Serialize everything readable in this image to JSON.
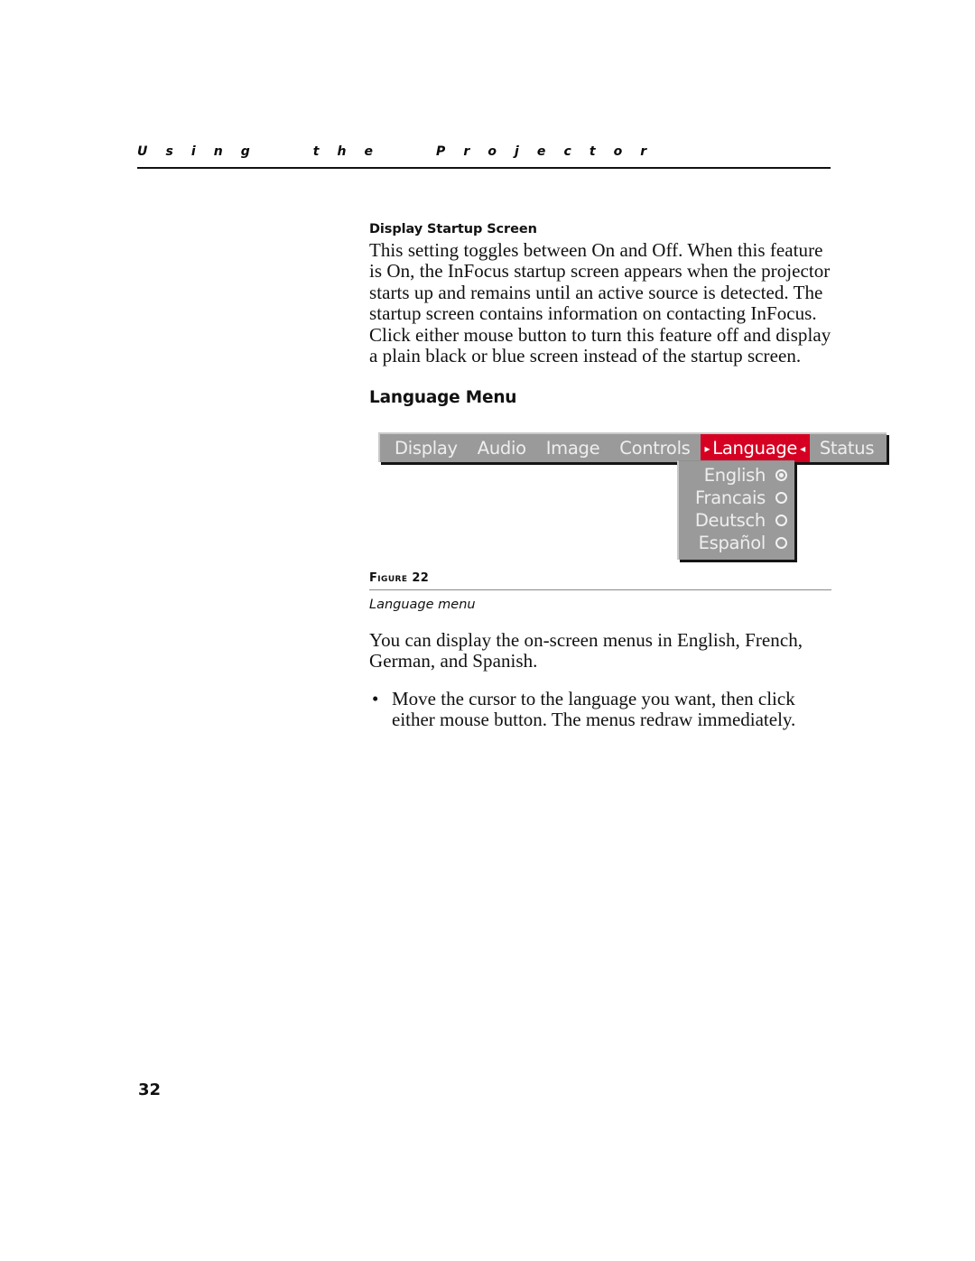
{
  "header": {
    "running_title": "U s i n g     t h e     P r o j e c t o r"
  },
  "section_startup": {
    "heading": "Display Startup Screen",
    "paragraph": "This setting toggles between On and Off. When this feature is On, the InFocus startup screen appears when the projector starts up and remains until an active source is detected. The startup screen contains information on contacting InFocus. Click either mouse button to turn this feature off and display a plain black or blue screen instead of the startup screen."
  },
  "section_language": {
    "heading": "Language Menu",
    "paragraph": "You can display the on-screen menus in English, French, German, and Spanish.",
    "bullets": [
      "Move the cursor to the language you want, then click either mouse button. The menus redraw immediately."
    ]
  },
  "figure": {
    "number_label": "FIGURE 22",
    "caption": "Language menu",
    "menu": {
      "bar_items": [
        {
          "label": "Display",
          "selected": false
        },
        {
          "label": "Audio",
          "selected": false
        },
        {
          "label": "Image",
          "selected": false
        },
        {
          "label": "Controls",
          "selected": false
        },
        {
          "label": "Language",
          "selected": true
        },
        {
          "label": "Status",
          "selected": false
        }
      ],
      "selected_marker_left": "▸",
      "selected_marker_right": "◂",
      "dropdown_items": [
        {
          "label": "English",
          "checked": true
        },
        {
          "label": "Francais",
          "checked": false
        },
        {
          "label": "Deutsch",
          "checked": false
        },
        {
          "label": "Español",
          "checked": false
        }
      ]
    },
    "colors": {
      "menu_background": "#9a9a9a",
      "menu_text": "#eeeeee",
      "highlight_red": "#d60022",
      "shadow": "#151515"
    }
  },
  "footer": {
    "page_number": "32"
  }
}
